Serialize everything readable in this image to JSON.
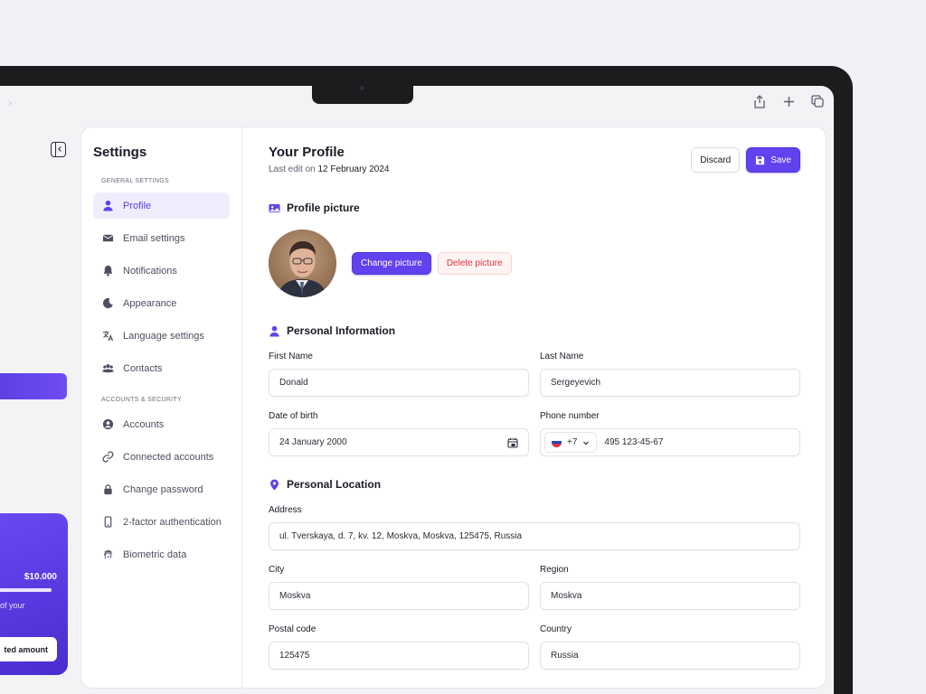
{
  "settings": {
    "title": "Settings",
    "general_section": "General settings",
    "security_section": "Accounts & Security",
    "general_items": [
      {
        "label": "Profile"
      },
      {
        "label": "Email settings"
      },
      {
        "label": "Notifications"
      },
      {
        "label": "Appearance"
      },
      {
        "label": "Language settings"
      },
      {
        "label": "Contacts"
      }
    ],
    "security_items": [
      {
        "label": "Accounts"
      },
      {
        "label": "Connected accounts"
      },
      {
        "label": "Change password"
      },
      {
        "label": "2-factor authentication"
      },
      {
        "label": "Biometric data"
      }
    ]
  },
  "profile": {
    "title": "Your Profile",
    "last_edit_prefix": "Last edit on",
    "last_edit_date": "12 February 2024",
    "discard_label": "Discard",
    "save_label": "Save"
  },
  "picture": {
    "heading": "Profile picture",
    "change_label": "Change picture",
    "delete_label": "Delete picture"
  },
  "personal": {
    "heading": "Personal Information",
    "first_name_label": "First Name",
    "first_name": "Donald",
    "last_name_label": "Last Name",
    "last_name": "Sergeyevich",
    "dob_label": "Date of birth",
    "dob": "24 January 2000",
    "phone_label": "Phone number",
    "phone_code": "+7",
    "phone": "495 123-45-67"
  },
  "location": {
    "heading": "Personal Location",
    "address_label": "Address",
    "address": "ul. Tverskaya, d. 7, kv. 12, Moskva, Moskva, 125475, Russia",
    "city_label": "City",
    "city": "Moskva",
    "region_label": "Region",
    "region": "Moskva",
    "postal_label": "Postal code",
    "postal": "125475",
    "country_label": "Country",
    "country": "Russia"
  },
  "background_app": {
    "amount": "$10.000",
    "progress": 1.0,
    "text_fragment": "of your",
    "button_fragment": "ted amount"
  },
  "colors": {
    "accent": "#6142ee",
    "danger": "#e0323c",
    "active_bg": "#efedfd"
  }
}
